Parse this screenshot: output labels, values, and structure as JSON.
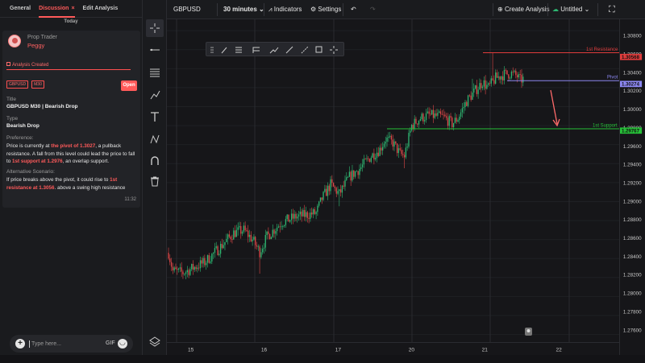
{
  "tabs": {
    "general": "General",
    "discussion": "Discussion",
    "close": "×",
    "edit": "Edit Analysis"
  },
  "feed": {
    "day": "Today"
  },
  "post": {
    "role": "Prop Trader",
    "user": "Peggy",
    "event": "Analysis Created",
    "tags": [
      "GBPUSD",
      "M30"
    ],
    "open_label": "Open",
    "title_label": "Title",
    "title": "GBPUSD M30 | Bearish Drop",
    "type_label": "Type",
    "type": "Bearish Drop",
    "preference_label": "Preference:",
    "preference": {
      "p1": "Price is currently at ",
      "h1": "the pivot of 1.3027",
      "p2": ", a pullback resistance. A fall from this level could lead the price to fall to ",
      "h2": "1st support at 1.2976",
      "p3": ", an overlap support."
    },
    "alternative_label": "Alternative Scenario:",
    "alternative": {
      "p1": "If price breaks above the pivot, it could rise to ",
      "h1": "1st resistance at 1.3056",
      "p2": ".  above a swing high resistance"
    },
    "time": "11:32"
  },
  "composer": {
    "placeholder": "Type here...",
    "gif": "GIF"
  },
  "toolbar": {
    "symbol": "GBPUSD",
    "interval": "30 minutes",
    "indicators": "Indicators",
    "settings": "Settings",
    "create": "Create Analysis",
    "doc": "Untitled"
  },
  "colors": {
    "accent": "#ff5a5a",
    "up": "#2eb872",
    "down": "#e04848",
    "resistance": "#e03c3c",
    "pivot": "#8b86f0",
    "support": "#26c038"
  },
  "chart_data": {
    "type": "candlestick",
    "symbol": "GBPUSD",
    "timeframe": "M30",
    "ylim": [
      1.2752,
      1.3092
    ],
    "yticks": [
      "1.30800",
      "1.30600",
      "1.30400",
      "1.30200",
      "1.30000",
      "1.29800",
      "1.29600",
      "1.29400",
      "1.29200",
      "1.29000",
      "1.28800",
      "1.28600",
      "1.28400",
      "1.28200",
      "1.28000",
      "1.27800",
      "1.27600"
    ],
    "xticks": [
      "15",
      "16",
      "17",
      "20",
      "21",
      "22"
    ],
    "path_anchors": [
      [
        0,
        1.2846
      ],
      [
        3,
        1.2827
      ],
      [
        10,
        1.2825
      ],
      [
        25,
        1.2836
      ],
      [
        35,
        1.2851
      ],
      [
        45,
        1.2867
      ],
      [
        52,
        1.287
      ],
      [
        58,
        1.286
      ],
      [
        63,
        1.2847
      ],
      [
        68,
        1.2863
      ],
      [
        78,
        1.2878
      ],
      [
        88,
        1.2884
      ],
      [
        95,
        1.2886
      ],
      [
        102,
        1.2888
      ],
      [
        106,
        1.2903
      ],
      [
        112,
        1.2918
      ],
      [
        118,
        1.2908
      ],
      [
        125,
        1.2926
      ],
      [
        133,
        1.2936
      ],
      [
        140,
        1.2948
      ],
      [
        146,
        1.2955
      ],
      [
        150,
        1.2966
      ],
      [
        155,
        1.2962
      ],
      [
        160,
        1.295
      ],
      [
        163,
        1.2948
      ],
      [
        168,
        1.298
      ],
      [
        174,
        1.2988
      ],
      [
        180,
        1.2991
      ],
      [
        190,
        1.2989
      ],
      [
        196,
        1.2982
      ],
      [
        200,
        1.2988
      ],
      [
        206,
        1.3006
      ],
      [
        212,
        1.3017
      ],
      [
        217,
        1.3026
      ],
      [
        221,
        1.302
      ],
      [
        226,
        1.303
      ],
      [
        232,
        1.3034
      ],
      [
        237,
        1.3035
      ],
      [
        241,
        1.3032
      ],
      [
        243,
        1.3028
      ],
      [
        245,
        1.3029
      ]
    ],
    "levels": [
      {
        "name": "1st Resistance",
        "value": 1.30568,
        "label": "1.30568"
      },
      {
        "name": "Pivot",
        "value": 1.30274,
        "label": "1.30274"
      },
      {
        "name": "1st Support",
        "value": 1.29767,
        "label": "1.29767"
      }
    ],
    "projection": "down-arrow from pivot toward 1st support"
  }
}
